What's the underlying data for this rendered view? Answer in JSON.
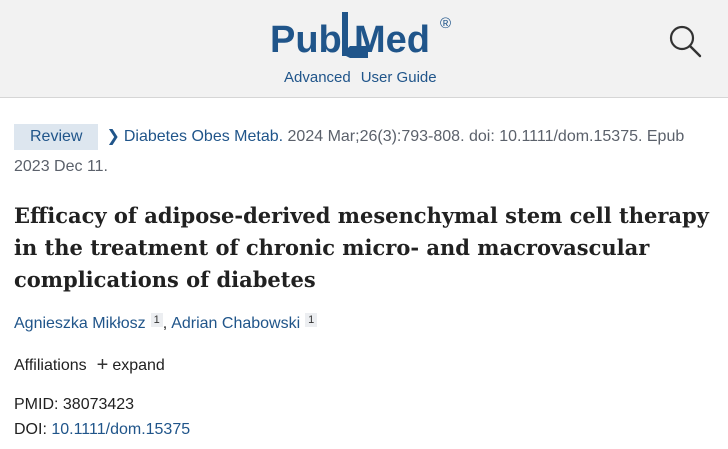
{
  "header": {
    "logo_text_left": "Pub",
    "logo_text_right": "Med",
    "logo_reg": "®",
    "links": {
      "advanced": "Advanced",
      "user_guide": "User Guide"
    },
    "search_icon": "search-icon",
    "colors": {
      "brand": "#20558a",
      "bar": "#f2f2f2"
    }
  },
  "article": {
    "type_badge": "Review",
    "journal": "Diabetes Obes Metab.",
    "citation_rest": " 2024 Mar;26(3):793-808. doi: 10.1111/dom.15375. Epub 2023 Dec 11.",
    "title": "Efficacy of adipose-derived mesenchymal stem cell therapy in the treatment of chronic micro- and macrovascular complications of diabetes",
    "authors": [
      {
        "name": "Agnieszka Mikłosz",
        "affiliation": "1"
      },
      {
        "name": "Adrian Chabowski",
        "affiliation": "1"
      }
    ],
    "author_separator": ",",
    "affiliations_label": "Affiliations",
    "expand_label": "expand",
    "expand_icon": "plus-icon",
    "pmid_label": "PMID: ",
    "pmid": "38073423",
    "doi_label": "DOI: ",
    "doi": "10.1111/dom.15375"
  }
}
